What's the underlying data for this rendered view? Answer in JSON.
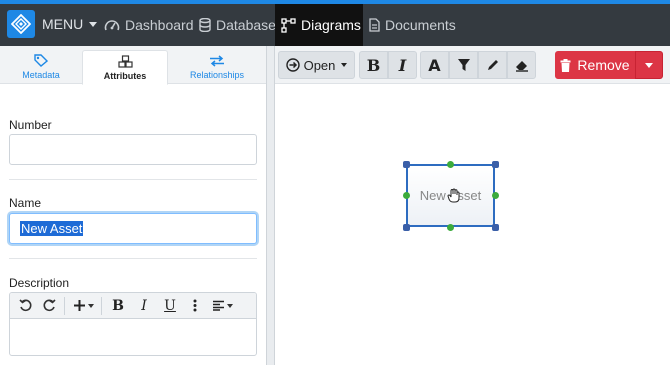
{
  "nav": {
    "menu_label": "MENU",
    "items": [
      {
        "label": "Dashboard",
        "icon": "dashboard-icon"
      },
      {
        "label": "Database",
        "icon": "database-icon"
      },
      {
        "label": "Diagrams",
        "icon": "diagram-icon",
        "active": true
      },
      {
        "label": "Documents",
        "icon": "document-icon"
      }
    ],
    "brand_color": "#1e88e5"
  },
  "sidebar": {
    "tabs": [
      {
        "label": "Metadata",
        "icon": "tag-icon"
      },
      {
        "label": "Attributes",
        "icon": "cubes-icon",
        "active": true
      },
      {
        "label": "Relationships",
        "icon": "exchange-icon"
      }
    ],
    "fields": {
      "number": {
        "label": "Number",
        "value": ""
      },
      "name": {
        "label": "Name",
        "value": "New Asset"
      },
      "description": {
        "label": "Description",
        "value": ""
      }
    }
  },
  "toolbar": {
    "open_label": "Open",
    "remove_label": "Remove",
    "danger_color": "#dc3545"
  },
  "canvas": {
    "node_label": "New Asset"
  }
}
